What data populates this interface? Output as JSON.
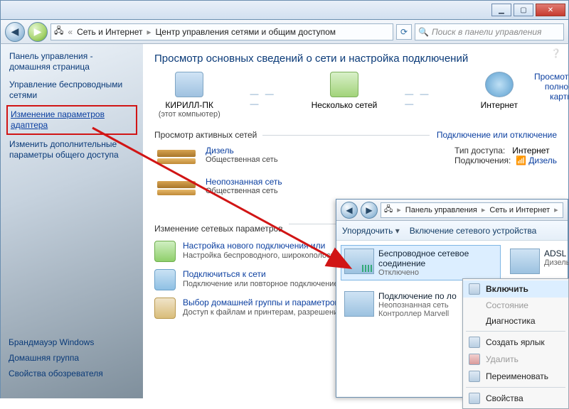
{
  "titlebar": {
    "min": "▁",
    "max": "▢",
    "close": "✕"
  },
  "nav": {
    "back": "◀",
    "fwd": "▶",
    "crumb1": "Сеть и Интернет",
    "crumb2": "Центр управления сетями и общим доступом",
    "sep": "▸",
    "refresh": "⟳",
    "search_placeholder": "Поиск в панели управления",
    "search_icon": "🔍"
  },
  "sidebar": {
    "title": "Панель управления - домашняя страница",
    "wifi": "Управление беспроводными сетями",
    "adapter": "Изменение параметров адаптера",
    "sharing": "Изменить дополнительные параметры общего доступа",
    "bottom": {
      "firewall": "Брандмауэр Windows",
      "homegroup": "Домашняя группа",
      "browser": "Свойства обозревателя"
    }
  },
  "content": {
    "heading": "Просмотр основных сведений о сети и настройка подключений",
    "map_link": "Просмотр полной карты",
    "pc_name": "КИРИЛЛ-ПК",
    "pc_sub": "(этот компьютер)",
    "multi": "Несколько сетей",
    "internet": "Интернет",
    "active_hdr": "Просмотр активных сетей",
    "conn_toggle": "Подключение или отключение",
    "net1": {
      "name": "Дизель",
      "type": "Общественная сеть"
    },
    "net2": {
      "name": "Неопознанная сеть",
      "type": "Общественная сеть"
    },
    "access_label": "Тип доступа:",
    "access_value": "Интернет",
    "conn_label": "Подключения:",
    "conn_value": "Дизель",
    "params_hdr": "Изменение сетевых параметров",
    "task1": {
      "title": "Настройка нового подключения или",
      "desc": "Настройка беспроводного, широкополосного или же настройка маршрутизатора и"
    },
    "task2": {
      "title": "Подключиться к сети",
      "desc": "Подключение или повторное подключение к сетевому соединению или подключение"
    },
    "task3": {
      "title": "Выбор домашней группы и параметров",
      "desc": "Доступ к файлам и принтерам, разрешение параметров общего доступа"
    }
  },
  "subwin": {
    "crumb1": "Панель управления",
    "crumb2": "Сеть и Интернет",
    "tool1": "Упорядочить",
    "tool2": "Включение сетевого устройства",
    "wifi_name": "Беспроводное сетевое соединение",
    "wifi_stat": "Отключено",
    "adsl_name": "ADSL",
    "adsl_stat": "Дизель",
    "lan_name": "Подключение по ло",
    "lan_stat1": "Неопознанная сеть",
    "lan_stat2": "Контроллер Marvell"
  },
  "ctx": {
    "enable": "Включить",
    "status": "Состояние",
    "diag": "Диагностика",
    "shortcut": "Создать ярлык",
    "delete": "Удалить",
    "rename": "Переименовать",
    "props": "Свойства"
  }
}
